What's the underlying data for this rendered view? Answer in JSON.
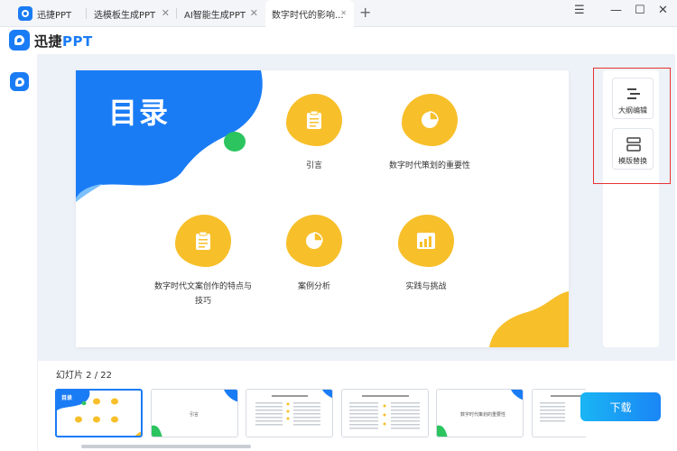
{
  "tabs": [
    {
      "label": "迅捷PPT"
    },
    {
      "label": "选模板生成PPT"
    },
    {
      "label": "AI智能生成PPT"
    },
    {
      "label": "数字时代的影响..."
    }
  ],
  "window_controls": {
    "menu": "☰",
    "minimize": "—",
    "maximize": "☐",
    "close": "✕"
  },
  "app": {
    "name_main": "迅捷",
    "name_accent": "PPT"
  },
  "slide": {
    "title": "目录",
    "items": [
      {
        "label": "引言",
        "icon": "clipboard-icon"
      },
      {
        "label": "数字时代策划的重要性",
        "icon": "pie-chart-icon"
      },
      {
        "label": "数字时代文案创作的特点与技巧",
        "icon": "clipboard-icon"
      },
      {
        "label": "案例分析",
        "icon": "pie-chart-icon"
      },
      {
        "label": "实践与挑战",
        "icon": "bar-chart-icon"
      }
    ]
  },
  "side_panel": {
    "outline_label": "大纲编辑",
    "template_label": "模版替换"
  },
  "thumbnails": {
    "counter": "幻灯片 2 / 22",
    "t1_title": "目录",
    "t2_title": "引言",
    "t5_title": "数字时代策划的重要性"
  },
  "download_label": "下载",
  "colors": {
    "accent": "#1a7cf5",
    "yellow": "#f7bf2a",
    "green": "#2bc45f",
    "highlight": "#e53333"
  }
}
